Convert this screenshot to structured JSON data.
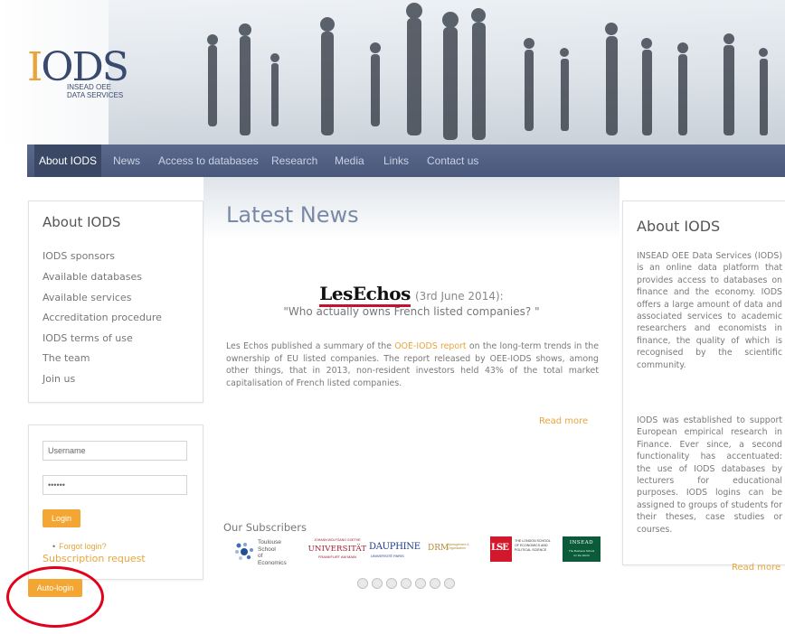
{
  "colors": {
    "accent": "#f3a632",
    "nav_bg": "#48577a",
    "nav_active": "#3a4866",
    "annotation_ring": "#e3001b"
  },
  "logo": {
    "mark_first": "I",
    "mark_rest": "ODS",
    "subtitle_line1": "INSEAD OEE",
    "subtitle_line2": "DATA SERVICES"
  },
  "nav": {
    "items": [
      {
        "label": "About IODS",
        "active": true
      },
      {
        "label": "News"
      },
      {
        "label": "Access to databases"
      },
      {
        "label": "Research"
      },
      {
        "label": "Media"
      },
      {
        "label": "Links"
      },
      {
        "label": "Contact us"
      }
    ]
  },
  "sidebar": {
    "title": "About IODS",
    "items": [
      {
        "label": "IODS sponsors"
      },
      {
        "label": "Available databases"
      },
      {
        "label": "Available services"
      },
      {
        "label": "Accreditation procedure"
      },
      {
        "label": "IODS terms of use"
      },
      {
        "label": "The team"
      },
      {
        "label": "Join us"
      }
    ]
  },
  "login": {
    "username_value": "Username",
    "password_value": "••••••",
    "login_label": "Login",
    "forgot_label": "Forgot login?",
    "subscription_label": "Subscription request",
    "autologin_label": "Auto-login"
  },
  "news": {
    "heading": "Latest News",
    "source_brand": "LesEchos",
    "date": "(3rd June 2014):",
    "quote": "\"Who actually owns French listed companies? \"",
    "body_before": "Les Echos published a summary of the ",
    "body_link": "OOE-IODS report",
    "body_after": " on the long-term trends in the ownership of EU listed companies. The report released by OEE-IODS shows, among other things, that in 2013, non-resident investors held 43% of the total market capitalisation of French listed companies.",
    "read_more": "Read more"
  },
  "subscribers": {
    "title": "Our Subscribers",
    "logos": [
      {
        "icon": "toulouse-logo",
        "line1": "Toulouse",
        "line2": "School",
        "line3": "of Economics"
      },
      {
        "icon": "frankfurt-logo",
        "line1": "JOHANN WOLFGANG GOETHE",
        "line2": "UNIVERSITÄT",
        "line3": "FRANKFURT AM MAIN"
      },
      {
        "icon": "dauphine-logo",
        "line1": "DAUPHINE",
        "line2": "UNIVERSITÉ PARIS"
      },
      {
        "icon": "drm-logo",
        "line1": "DRM",
        "line2": "Management & Organisation"
      },
      {
        "icon": "lse-logo",
        "line1": "LSE",
        "line2": "THE LONDON SCHOOL",
        "line3": "OF ECONOMICS AND",
        "line4": "POLITICAL SCIENCE"
      },
      {
        "icon": "insead-logo",
        "line1": "INSEAD",
        "line2": "The Business School",
        "line3": "for the World"
      }
    ],
    "carousel_dots": 7
  },
  "about_panel": {
    "title": "About IODS",
    "para1": "INSEAD OEE Data Services (IODS) is an online data platform that provides access to databases on finance and the economy. IODS offers a large amount of data and associated services to academic researchers and economists in finance, the quality of which is recognised by the scientific community.",
    "para2": "IODS was established to support European empirical research in Finance. Ever since, a second functionality has accentuated: the use of IODS databases by lecturers for educational purposes. IODS logins can be assigned to groups of students for their theses, case studies or courses.",
    "read_more": "Read more"
  }
}
